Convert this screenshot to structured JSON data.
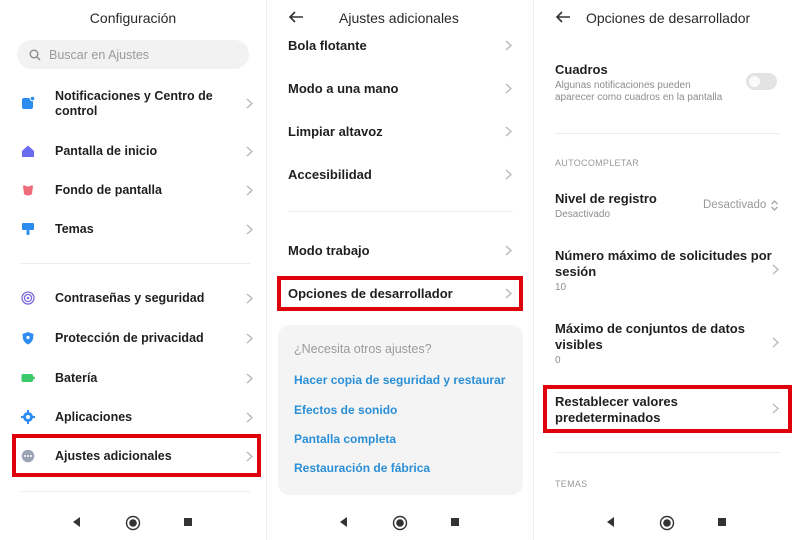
{
  "panel1": {
    "title": "Configuración",
    "search_placeholder": "Buscar en Ajustes",
    "items": [
      {
        "label_line1": "Notificaciones y Centro de",
        "label_line2": "control",
        "icon": "notification-icon",
        "color": "#2d8cf0"
      },
      {
        "label": "Pantalla de inicio",
        "icon": "home-icon",
        "color": "#6b6bf0"
      },
      {
        "label": "Fondo de pantalla",
        "icon": "wallpaper-icon",
        "color": "#f06b7a"
      },
      {
        "label": "Temas",
        "icon": "brush-icon",
        "color": "#2d8cf0"
      },
      {
        "label": "Contraseñas y seguridad",
        "icon": "fingerprint-icon",
        "color": "#7b6bd8"
      },
      {
        "label": "Protección de privacidad",
        "icon": "shield-icon",
        "color": "#2d8cf0"
      },
      {
        "label": "Batería",
        "icon": "battery-icon",
        "color": "#3cc96a"
      },
      {
        "label": "Aplicaciones",
        "icon": "gear-icon",
        "color": "#2d8cf0"
      },
      {
        "label": "Ajustes adicionales",
        "icon": "more-icon",
        "color": "#9aa4b4"
      }
    ]
  },
  "panel2": {
    "title": "Ajustes adicionales",
    "items": [
      {
        "label": "Bola flotante"
      },
      {
        "label": "Modo a una mano"
      },
      {
        "label": "Limpiar altavoz"
      },
      {
        "label": "Accesibilidad"
      },
      {
        "label": "Modo trabajo"
      },
      {
        "label": "Opciones de desarrollador"
      }
    ],
    "help_card": {
      "question": "¿Necesita otros ajustes?",
      "links": [
        "Hacer copia de seguridad y restaurar",
        "Efectos de sonido",
        "Pantalla completa",
        "Restauración de fábrica"
      ]
    }
  },
  "panel3": {
    "title": "Opciones de desarrollador",
    "cuadros": {
      "label": "Cuadros",
      "desc_line1": "Algunas notificaciones pueden",
      "desc_line2": "aparecer como cuadros en la pantalla",
      "toggle_on": false
    },
    "section_autocomplete": "AUTOCOMPLETAR",
    "nivel": {
      "label": "Nivel de registro",
      "sub": "Desactivado",
      "value": "Desactivado"
    },
    "max_req": {
      "label_line1": "Número máximo de solicitudes por",
      "label_line2": "sesión",
      "value": "10"
    },
    "max_sets": {
      "label_line1": "Máximo de conjuntos de datos",
      "label_line2": "visibles",
      "value": "0"
    },
    "restablecer": {
      "label_line1": "Restablecer valores",
      "label_line2": "predeterminados"
    },
    "section_temas": "TEMAS"
  },
  "colors": {
    "highlight": "#e0000b",
    "link": "#2a8fd6"
  }
}
